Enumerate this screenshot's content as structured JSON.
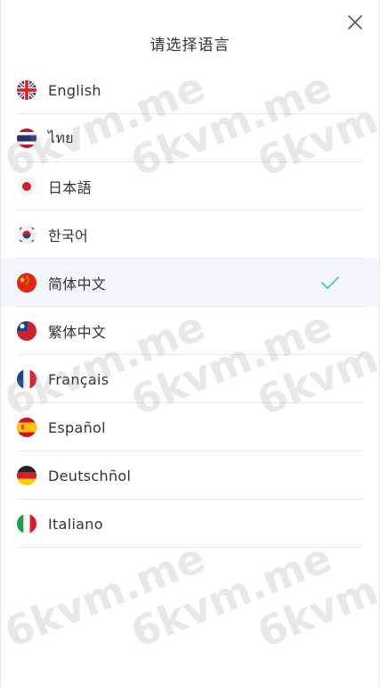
{
  "title": "请选择语言",
  "icons": {
    "close": "close-icon",
    "check": "check-icon"
  },
  "colors": {
    "selected_bg": "#f2f5fb",
    "check": "#3ccfc0",
    "divider": "#e9e9e9"
  },
  "languages": [
    {
      "label": "English",
      "flag": "uk-flag-icon",
      "selected": false
    },
    {
      "label": "ไทย",
      "flag": "thailand-flag-icon",
      "selected": false
    },
    {
      "label": "日本語",
      "flag": "japan-flag-icon",
      "selected": false
    },
    {
      "label": "한국어",
      "flag": "korea-flag-icon",
      "selected": false
    },
    {
      "label": "简体中文",
      "flag": "china-flag-icon",
      "selected": true
    },
    {
      "label": "繁体中文",
      "flag": "taiwan-flag-icon",
      "selected": false
    },
    {
      "label": "Français",
      "flag": "france-flag-icon",
      "selected": false
    },
    {
      "label": "Español",
      "flag": "spain-flag-icon",
      "selected": false
    },
    {
      "label": "Deutschñol",
      "flag": "germany-flag-icon",
      "selected": false
    },
    {
      "label": "Italiano",
      "flag": "italy-flag-icon",
      "selected": false
    }
  ],
  "watermark": "6kvm.me"
}
